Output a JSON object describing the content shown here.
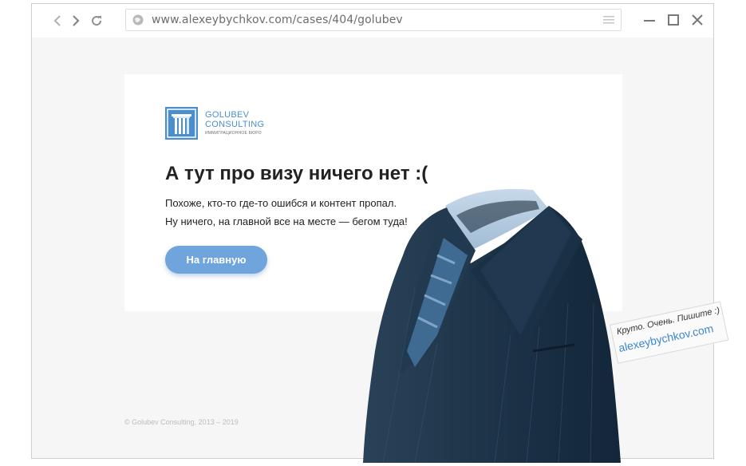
{
  "browser": {
    "url": "www.alexeybychkov.com/cases/404/golubev"
  },
  "logo": {
    "name_line1": "GOLUBEV",
    "name_line2": "CONSULTING",
    "tagline": "ИММИГРАЦИОННОЕ БЮРО"
  },
  "content": {
    "title": "А тут про визу ничего нет :(",
    "line1": "Похоже, кто-то где-то ошибся и контент пропал.",
    "line2": "Ну ничего, на главной все на месте — бегом туда!",
    "button": "На главную"
  },
  "footer": {
    "copyright": "© Golubev Consulting, 2013 – 2019"
  },
  "note": {
    "line1": "Круто. Очень. Пишите :)",
    "link": "alexeybychkov.com"
  },
  "colors": {
    "accent": "#4a8ed0",
    "button": "#6fa4dc",
    "suit": "#1f3448"
  }
}
